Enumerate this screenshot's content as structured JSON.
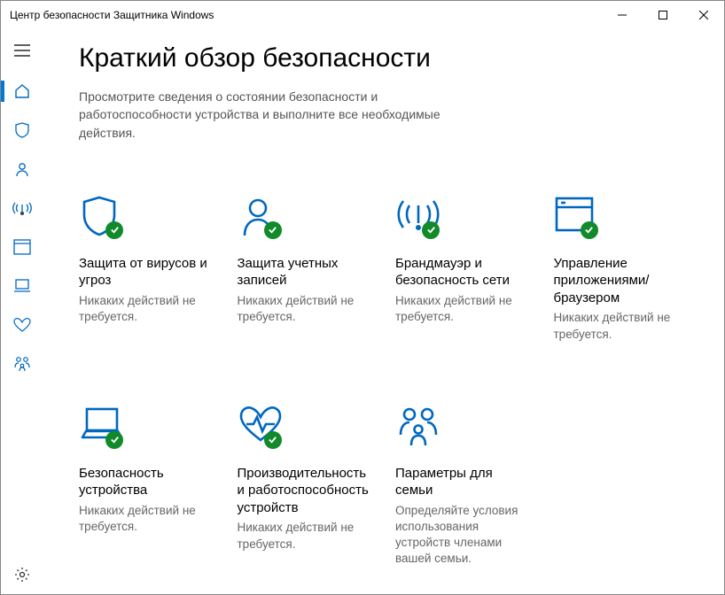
{
  "window": {
    "title": "Центр безопасности Защитника Windows"
  },
  "page": {
    "title": "Краткий обзор безопасности",
    "subtitle": "Просмотрите сведения о состоянии безопасности и работоспособности устройства и выполните все необходимые действия."
  },
  "tiles": {
    "virus": {
      "title": "Защита от вирусов и угроз",
      "status": "Никаких действий не требуется."
    },
    "account": {
      "title": "Защита учетных записей",
      "status": "Никаких действий не требуется."
    },
    "firewall": {
      "title": "Брандмауэр и безопасность сети",
      "status": "Никаких действий не требуется."
    },
    "app": {
      "title": "Управление приложениями/браузером",
      "status": "Никаких действий не требуется."
    },
    "device": {
      "title": "Безопасность устройства",
      "status": "Никаких действий не требуется."
    },
    "health": {
      "title": "Производительность и работоспособность устройств",
      "status": "Никаких действий не требуется."
    },
    "family": {
      "title": "Параметры для семьи",
      "status": "Определяйте условия использования устройств членами вашей семьи."
    }
  }
}
